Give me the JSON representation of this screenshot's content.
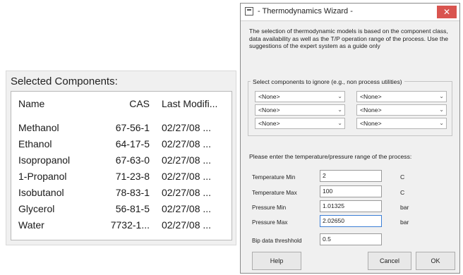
{
  "components": {
    "heading": "Selected Components:",
    "columns": {
      "name": "Name",
      "cas": "CAS",
      "modified": "Last Modifi..."
    },
    "rows": [
      {
        "name": "Methanol",
        "cas": "67-56-1",
        "modified": "02/27/08 ..."
      },
      {
        "name": "Ethanol",
        "cas": "64-17-5",
        "modified": "02/27/08 ..."
      },
      {
        "name": "Isopropanol",
        "cas": "67-63-0",
        "modified": "02/27/08 ..."
      },
      {
        "name": "1-Propanol",
        "cas": "71-23-8",
        "modified": "02/27/08 ..."
      },
      {
        "name": "Isobutanol",
        "cas": "78-83-1",
        "modified": "02/27/08 ..."
      },
      {
        "name": "Glycerol",
        "cas": "56-81-5",
        "modified": "02/27/08 ..."
      },
      {
        "name": "Water",
        "cas": "7732-1...",
        "modified": "02/27/08 ..."
      }
    ]
  },
  "wizard": {
    "title": "- Thermodynamics Wizard -",
    "close_label": "✕",
    "intro": "The selection of thermodynamic models is based on the component class, data availability as well as the T/P operation range of the process. Use the suggestions of the expert system as a guide only",
    "ignore_group": {
      "title": "Select components to ignore (e.g., non process utilities)",
      "combos": [
        "<None>",
        "<None>",
        "<None>",
        "<None>",
        "<None>",
        "<None>"
      ]
    },
    "range_label": "Please enter the temperature/pressure range of the process:",
    "fields": {
      "temp_min": {
        "label": "Temperature Min",
        "value": "2",
        "unit": "C"
      },
      "temp_max": {
        "label": "Temperature Max",
        "value": "100",
        "unit": "C"
      },
      "press_min": {
        "label": "Pressure Min",
        "value": "1.01325",
        "unit": "bar"
      },
      "press_max": {
        "label": "Pressure Max",
        "value": "2.02650",
        "unit": "bar"
      },
      "bip": {
        "label": "Bip data threshhold",
        "value": "0.5"
      }
    },
    "buttons": {
      "help": "Help",
      "cancel": "Cancel",
      "ok": "OK"
    }
  }
}
